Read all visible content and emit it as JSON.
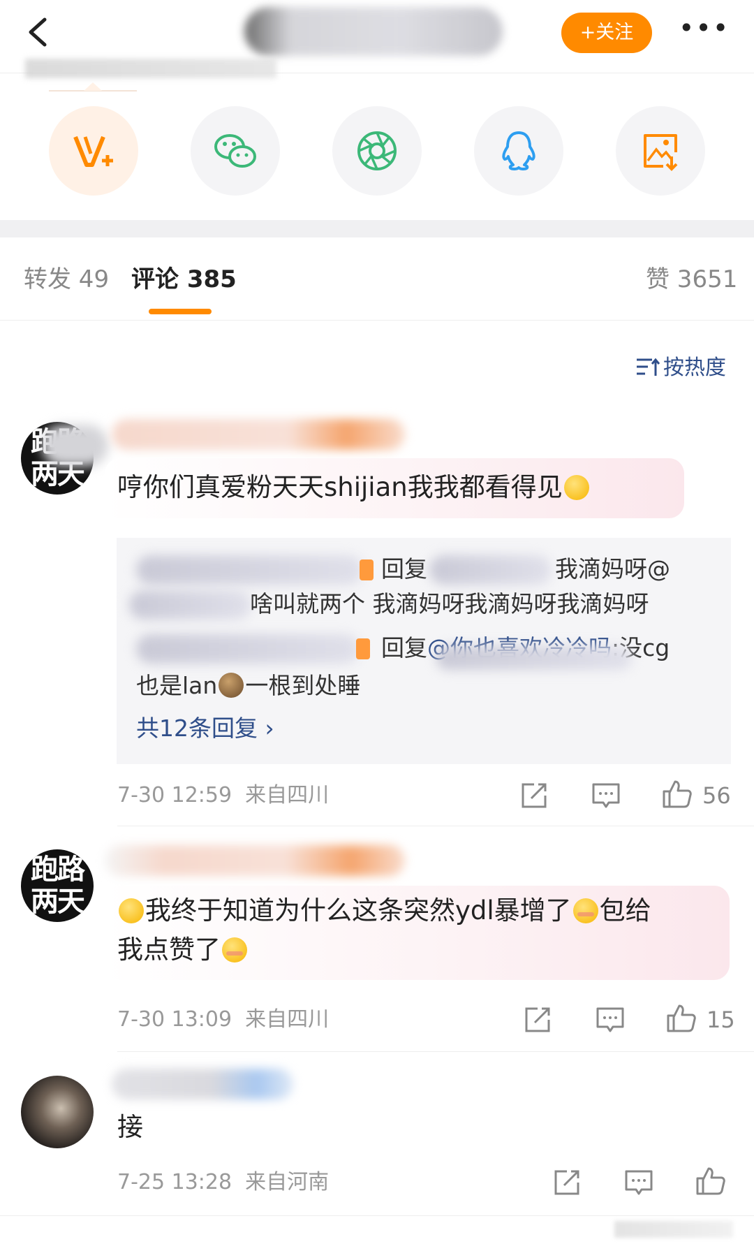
{
  "header": {
    "follow_label": "+关注",
    "more_label": "•••"
  },
  "share_targets": [
    {
      "name": "weibo-vplus-icon"
    },
    {
      "name": "wechat-icon"
    },
    {
      "name": "moments-icon"
    },
    {
      "name": "qq-icon"
    },
    {
      "name": "save-image-icon"
    }
  ],
  "tabs": {
    "repost": "转发 49",
    "comments": "评论 385",
    "likes": "赞 3651"
  },
  "sort_label": "按热度",
  "comments": [
    {
      "avatar_text": "跑路两天",
      "text": "哼你们真爱粉天天shijian我我都看得见",
      "replies": {
        "r1_reply_word": "回复",
        "r1_tail": "我滴妈呀@",
        "r1_line2": "啥叫就两个 我滴妈呀我滴妈呀我滴妈呀",
        "r2_reply_word": "回复",
        "r2_link": "@你也喜欢冷冷吗",
        "r2_tail": ":没cg",
        "r2_line2": "也是lan",
        "r2_line2_tail": "一根到处睡",
        "more_label": "共12条回复 ›"
      },
      "time": "7-30 12:59",
      "location": "来自四川",
      "likes": "56"
    },
    {
      "avatar_text": "跑路两天",
      "text_part1": "我终于知道为什么这条突然ydl暴增了",
      "text_part2": "包给",
      "text_line2": "我点赞了",
      "time": "7-30 13:09",
      "location": "来自四川",
      "likes": "15"
    },
    {
      "text": "接",
      "time": "7-25 13:28",
      "location": "来自河南",
      "likes": ""
    }
  ],
  "colors": {
    "accent": "#ff8a00",
    "link": "#2f4e8a",
    "reply_bg": "#f5f5f7"
  }
}
